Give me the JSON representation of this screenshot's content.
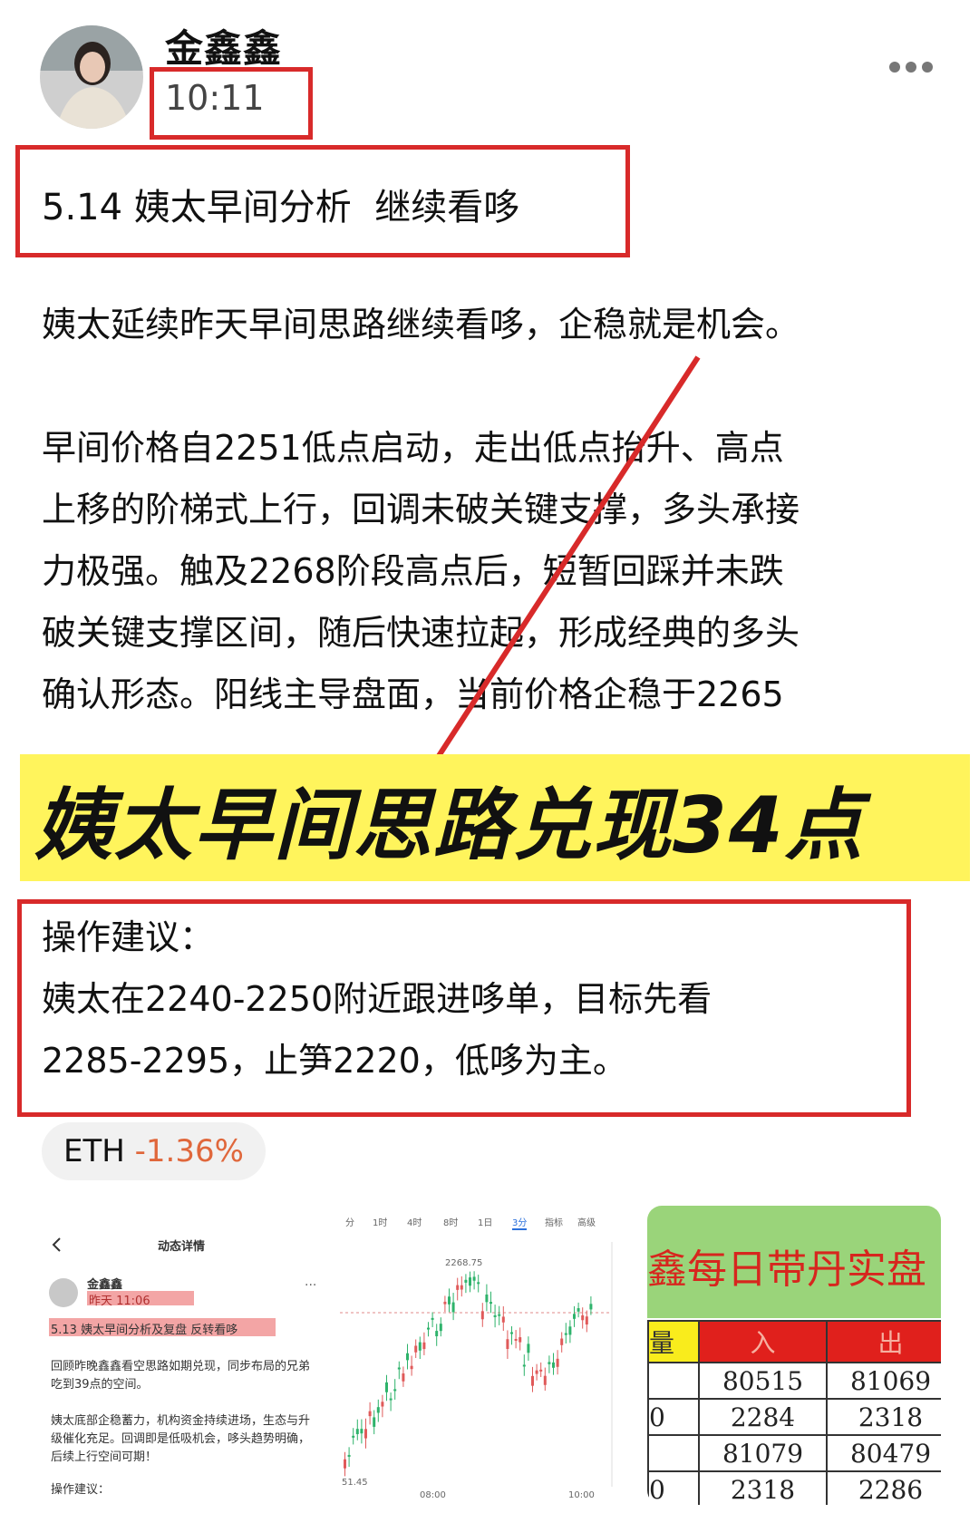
{
  "post": {
    "author": "金鑫鑫",
    "time": "10:11",
    "title": "5.14 姨太早间分析  继续看哆",
    "paragraph1": "姨太延续昨天早间思路继续看哆，企稳就是机会。",
    "paragraph2_lines": [
      "早间价格自2251低点启动，走出低点抬升、高点",
      "上移的阶梯式上行，回调未破关键支撑，多头承接",
      "力极强。触及2268阶段高点后，短暂回踩并未跌",
      "破关键支撑区间，随后快速拉起，形成经典的多头",
      "确认形态。阳线主导盘面，当前价格企稳于2265"
    ],
    "banner": "姨太早间思路兑现34点",
    "operation": {
      "heading": "操作建议：",
      "line1": "姨太在2240-2250附近跟进哆单，目标先看",
      "line2": "2285-2295，止笋2220，低哆为主。"
    },
    "tag": {
      "symbol": "ETH",
      "change": "-1.36%"
    }
  },
  "thumb1": {
    "screen_title": "动态详情",
    "author": "金鑫鑫",
    "time": "昨天 11:06",
    "title": "5.13 姨太早间分析及复盘   反转看哆",
    "p1": [
      "回顾昨晚鑫鑫看空思路如期兑现，同步布局的兄弟",
      "吃到39点的空间。"
    ],
    "p2": [
      "姨太底部企稳蓄力，机构资金持续进场，生态与升",
      "级催化充足。回调即是低吸机会，哆头趋势明确，",
      "后续上行空间可期！"
    ],
    "op": "操作建议："
  },
  "thumb2": {
    "tabs": [
      "分",
      "1时",
      "4时",
      "8时",
      "1日",
      "3分",
      "指标",
      "高级"
    ],
    "active_tab": "3分",
    "high_label": "2268.75",
    "low_label": "51.45",
    "x_labels": [
      "08:00",
      "10:00"
    ]
  },
  "thumb3": {
    "title": "鑫每日带丹实盘",
    "headers": [
      "量",
      "入",
      "出"
    ],
    "rows": [
      [
        "",
        "80515",
        "81069"
      ],
      [
        "0",
        "2284",
        "2318"
      ],
      [
        "",
        "81079",
        "80479"
      ],
      [
        "0",
        "2318",
        "2286"
      ]
    ]
  },
  "colors": {
    "highlight_box": "#d82a2a",
    "banner_bg": "#fff45c",
    "negative": "#e0673b"
  }
}
